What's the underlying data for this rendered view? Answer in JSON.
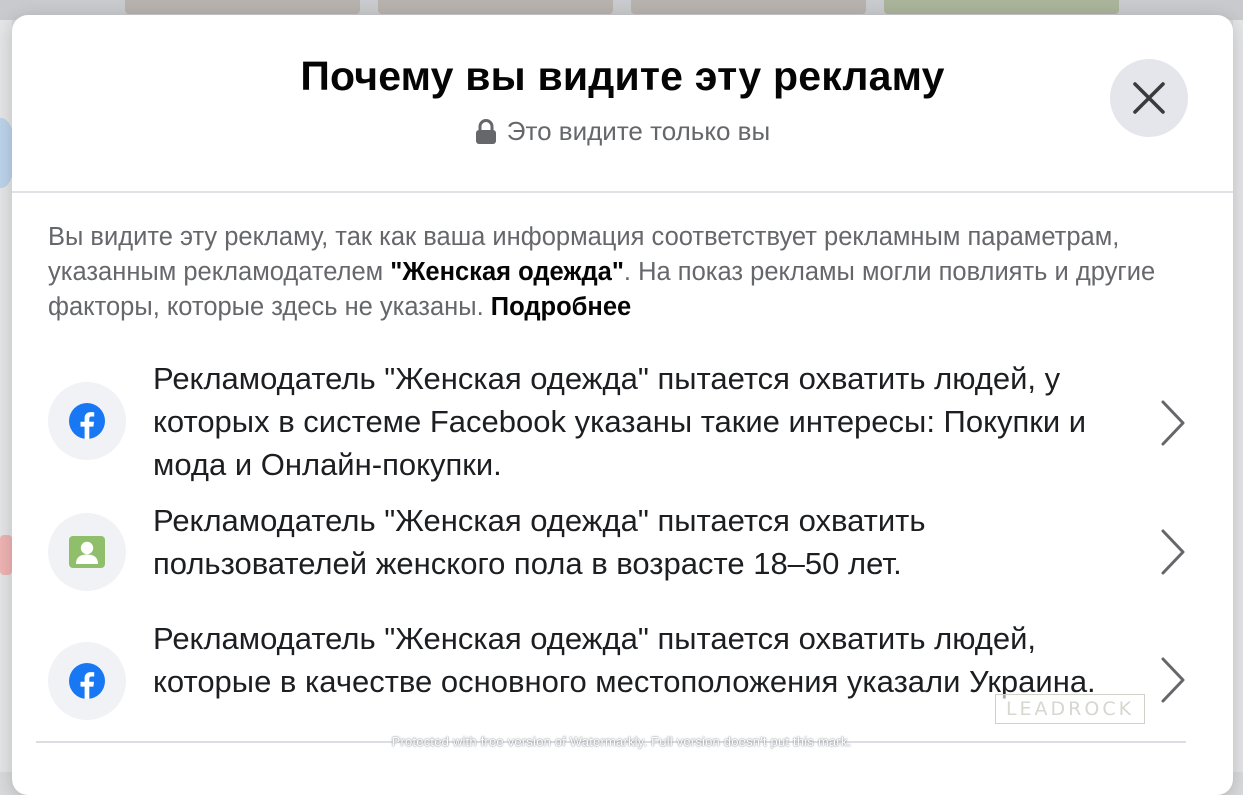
{
  "modal": {
    "title": "Почему вы видите эту рекламу",
    "privacy_note": "Это видите только вы",
    "close_label": "×"
  },
  "intro": {
    "part1": "Вы видите эту рекламу, так как ваша информация соответствует рекламным параметрам, указанным рекламодателем ",
    "advertiser": "\"Женская одежда\"",
    "part2": ". На показ рекламы могли повлиять и другие факторы, которые здесь не указаны. ",
    "learn_more": "Подробнее"
  },
  "reasons": [
    {
      "icon": "facebook-icon",
      "text": "Рекламодатель \"Женская одежда\" пытается охватить людей, у которых в системе Facebook указаны такие интересы: Покупки и мода и Онлайн-покупки."
    },
    {
      "icon": "user-card-icon",
      "text": "Рекламодатель \"Женская одежда\" пытается охватить пользователей женского пола в возрасте 18–50 лет."
    },
    {
      "icon": "facebook-icon",
      "text": "Рекламодатель \"Женская одежда\" пытается охватить людей, которые в качестве основного местоположения указали Украина."
    }
  ],
  "watermarks": {
    "logo": "LEADROCK",
    "notice": "Protected with free version of Watermarkly. Full version doesn't put this mark."
  },
  "colors": {
    "facebook_blue": "#1877f2",
    "user_card_green": "#8fbf6a",
    "secondary_text": "#65676b",
    "primary_text": "#050505",
    "close_bg": "#e4e6eb"
  }
}
